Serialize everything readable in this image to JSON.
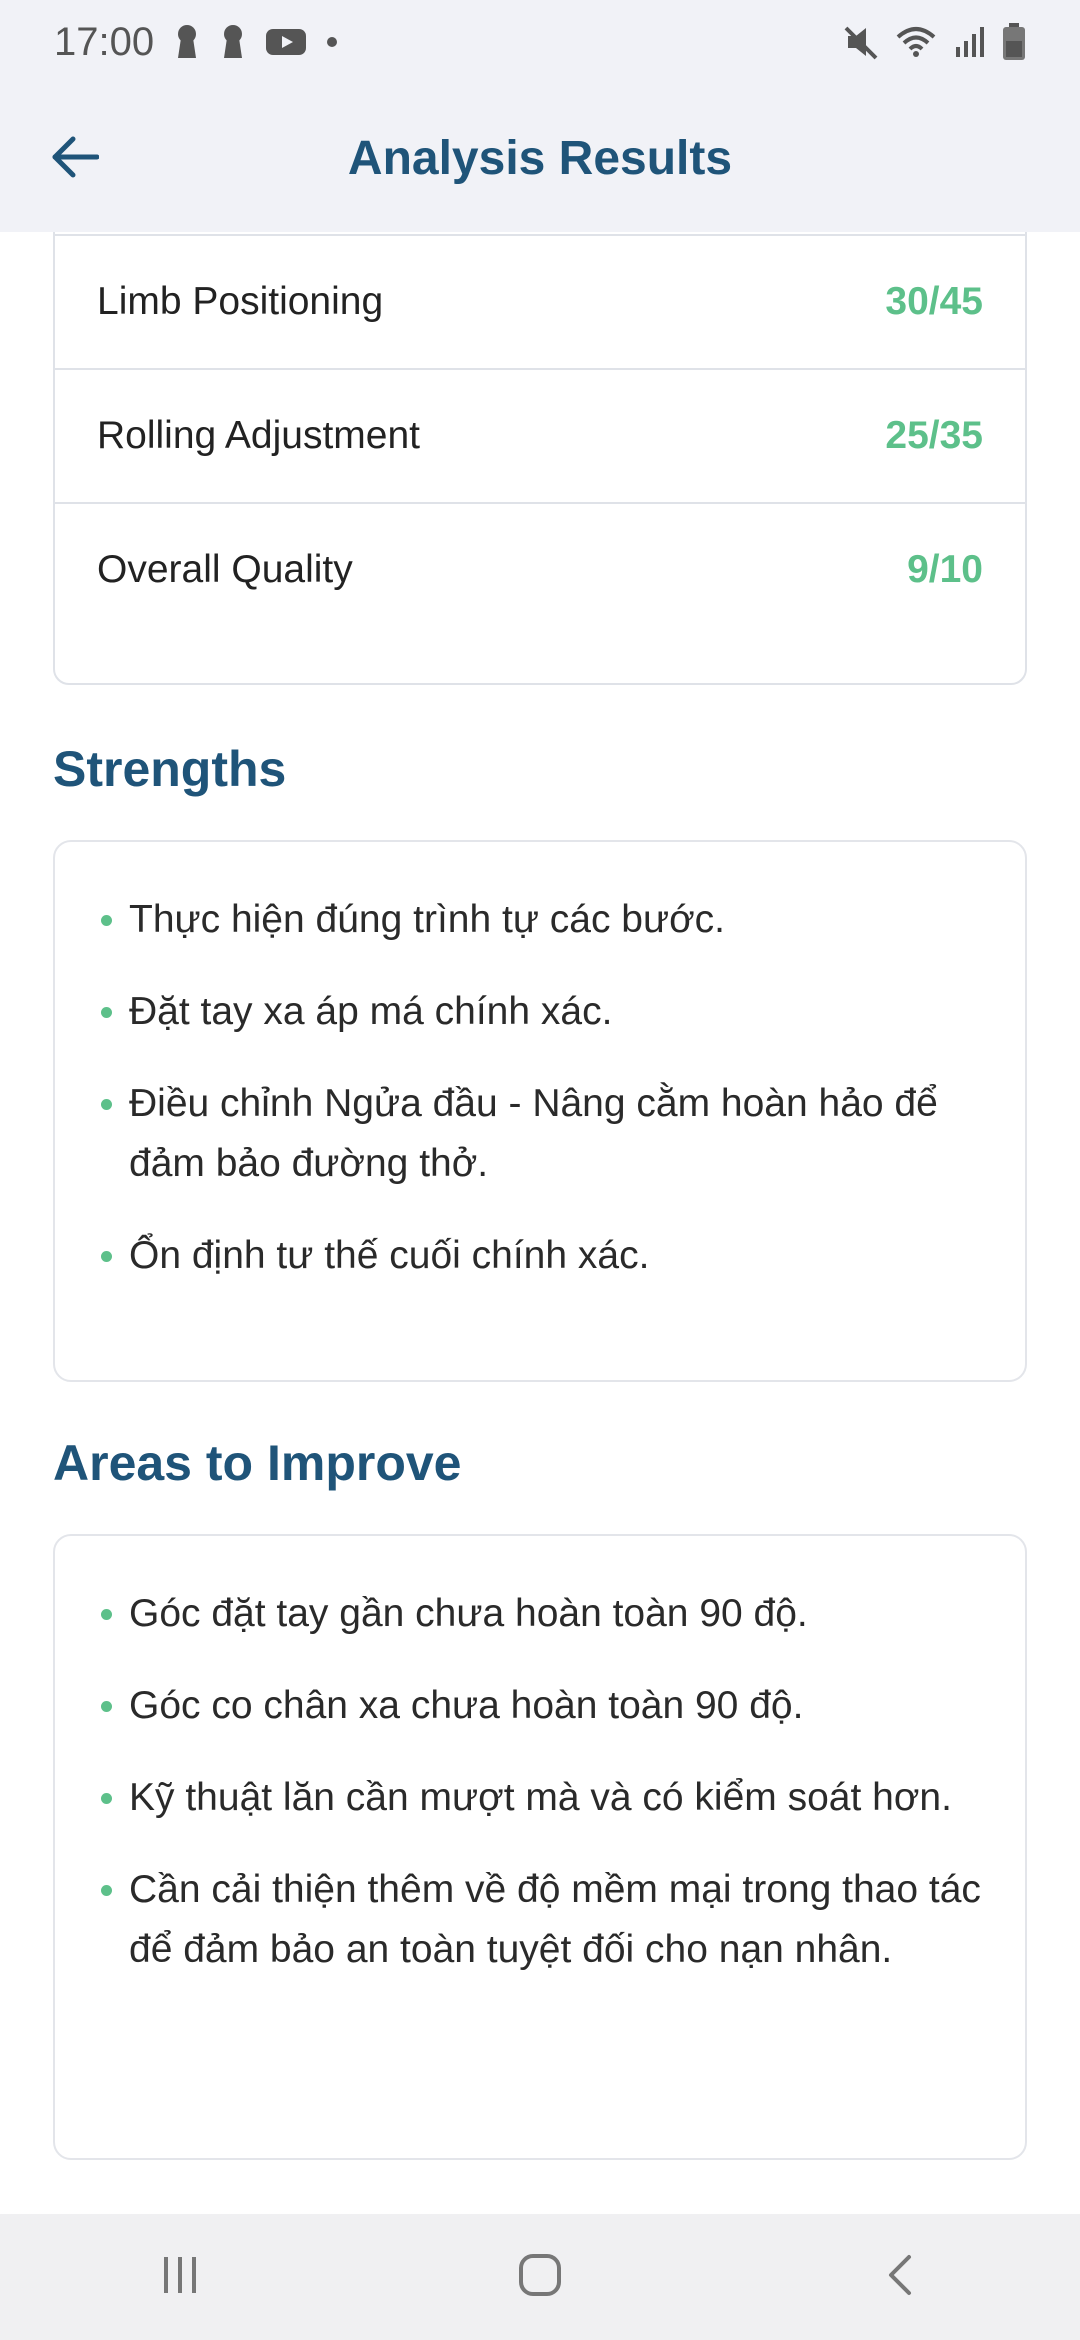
{
  "status_bar": {
    "time": "17:00",
    "left_icons": [
      "keyhole-icon",
      "keyhole-icon",
      "youtube-icon",
      "dot-icon"
    ],
    "right_icons": [
      "mute-icon",
      "wifi-icon",
      "signal-icon",
      "battery-icon"
    ]
  },
  "app_bar": {
    "title": "Analysis Results",
    "back_icon": "arrow-left-icon"
  },
  "scores": [
    {
      "label": "Limb Positioning",
      "value": "30/45"
    },
    {
      "label": "Rolling Adjustment",
      "value": "25/35"
    },
    {
      "label": "Overall Quality",
      "value": "9/10"
    }
  ],
  "strengths": {
    "title": "Strengths",
    "items": [
      "Thực hiện đúng trình tự các bước.",
      "Đặt tay xa áp má chính xác.",
      "Điều chỉnh Ngửa đầu - Nâng cằm hoàn hảo để đảm bảo đường thở.",
      "Ổn định tư thế cuối chính xác."
    ]
  },
  "improve": {
    "title": "Areas to Improve",
    "items": [
      "Góc đặt tay gần chưa hoàn toàn 90 độ.",
      "Góc co chân xa chưa hoàn toàn 90 độ.",
      "Kỹ thuật lăn cần mượt mà và có kiểm soát hơn.",
      "Cần cải thiện thêm về độ mềm mại trong thao tác để đảm bảo an toàn tuyệt đối cho nạn nhân."
    ]
  },
  "nav_bar": {
    "icons": [
      "recent-apps-icon",
      "home-icon",
      "back-icon"
    ]
  },
  "colors": {
    "accent_title": "#1f5479",
    "score_green": "#5dc08a",
    "bar_bg": "#f1f2f7"
  }
}
